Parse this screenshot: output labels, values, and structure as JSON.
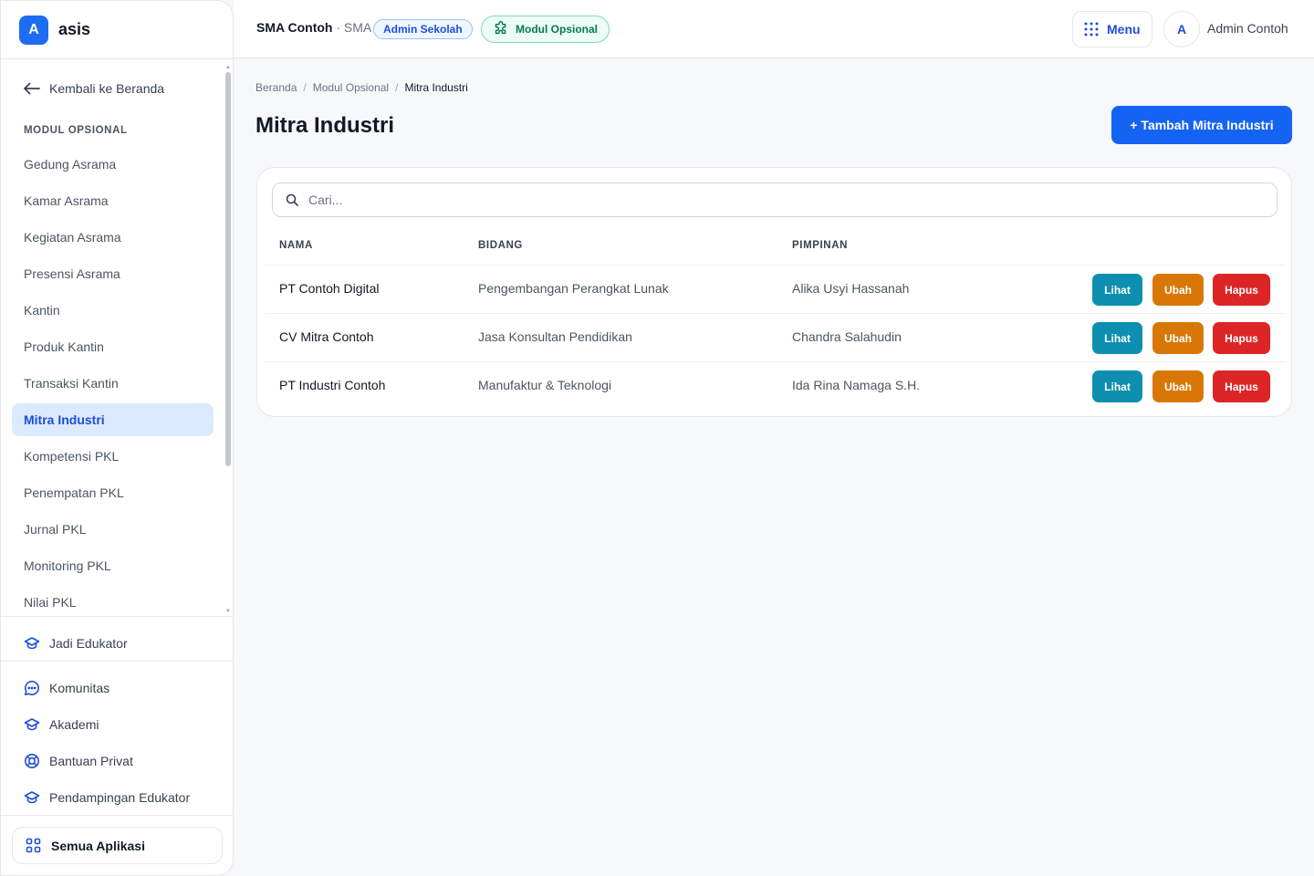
{
  "brand": {
    "logo_letter": "A",
    "name": "asis",
    "color": "#1d6cf2"
  },
  "sidebar": {
    "back_label": "Kembali ke Beranda",
    "section_title": "MODUL OPSIONAL",
    "items": [
      {
        "label": "Gedung Asrama"
      },
      {
        "label": "Kamar Asrama"
      },
      {
        "label": "Kegiatan Asrama"
      },
      {
        "label": "Presensi Asrama"
      },
      {
        "label": "Kantin"
      },
      {
        "label": "Produk Kantin"
      },
      {
        "label": "Transaksi Kantin"
      },
      {
        "label": "Mitra Industri",
        "active": true
      },
      {
        "label": "Kompetensi PKL"
      },
      {
        "label": "Penempatan PKL"
      },
      {
        "label": "Jurnal PKL"
      },
      {
        "label": "Monitoring PKL"
      },
      {
        "label": "Nilai PKL"
      }
    ],
    "educator_label": "Jadi Edukator",
    "links": [
      {
        "label": "Komunitas",
        "icon": "chat-icon"
      },
      {
        "label": "Akademi",
        "icon": "graduation-cap-icon"
      },
      {
        "label": "Bantuan Privat",
        "icon": "lifebuoy-icon"
      },
      {
        "label": "Pendampingan Edukator",
        "icon": "graduation-cap-icon"
      }
    ],
    "all_apps_label": "Semua Aplikasi"
  },
  "topbar": {
    "school_name": "SMA Contoh",
    "school_type": "· SMA",
    "role_badge": "Admin Sekolah",
    "module_badge": "Modul Opsional",
    "menu_label": "Menu",
    "avatar_letter": "A",
    "user_name": "Admin Contoh"
  },
  "breadcrumb": {
    "items": [
      "Beranda",
      "Modul Opsional"
    ],
    "current": "Mitra Industri",
    "separator": "/"
  },
  "page": {
    "title": "Mitra Industri",
    "add_button": "+ Tambah Mitra Industri"
  },
  "search": {
    "placeholder": "Cari..."
  },
  "table": {
    "headers": [
      "NAMA",
      "BIDANG",
      "PIMPINAN"
    ],
    "actions": {
      "view": "Lihat",
      "edit": "Ubah",
      "delete": "Hapus"
    },
    "rows": [
      {
        "name": "PT Contoh Digital",
        "field": "Pengembangan Perangkat Lunak",
        "lead": "Alika Usyi Hassanah"
      },
      {
        "name": "CV Mitra Contoh",
        "field": "Jasa Konsultan Pendidikan",
        "lead": "Chandra Salahudin"
      },
      {
        "name": "PT Industri Contoh",
        "field": "Manufaktur & Teknologi",
        "lead": "Ida Rina Namaga S.H."
      }
    ]
  },
  "colors": {
    "primary": "#1463f3",
    "view": "#0e8faf",
    "edit": "#d97706",
    "delete": "#dc2626",
    "active_bg": "#dbeafe"
  }
}
